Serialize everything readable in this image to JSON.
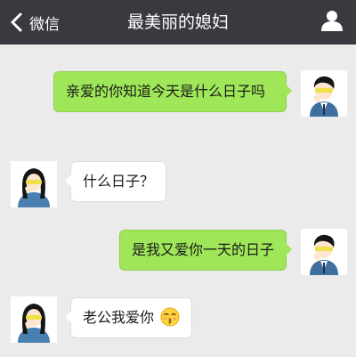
{
  "colors": {
    "navbar": "#393a3f",
    "background": "#ebebeb",
    "sent_bubble": "#9fe758",
    "received_bubble": "#ffffff"
  },
  "navbar": {
    "back_label": "微信",
    "back_icon": "chevron-left-icon",
    "title": "最美丽的媳妇",
    "profile_icon": "person-icon"
  },
  "messages": [
    {
      "side": "right",
      "sender": "self",
      "text": "亲爱的你知道今天是什么日子吗"
    },
    {
      "side": "left",
      "sender": "other",
      "text": "什么日子？"
    },
    {
      "side": "right",
      "sender": "self",
      "text": "是我又爱你一天的日子"
    },
    {
      "side": "left",
      "sender": "other",
      "text": "老公我爱你",
      "emoji": "kissing-face-emoji"
    }
  ]
}
